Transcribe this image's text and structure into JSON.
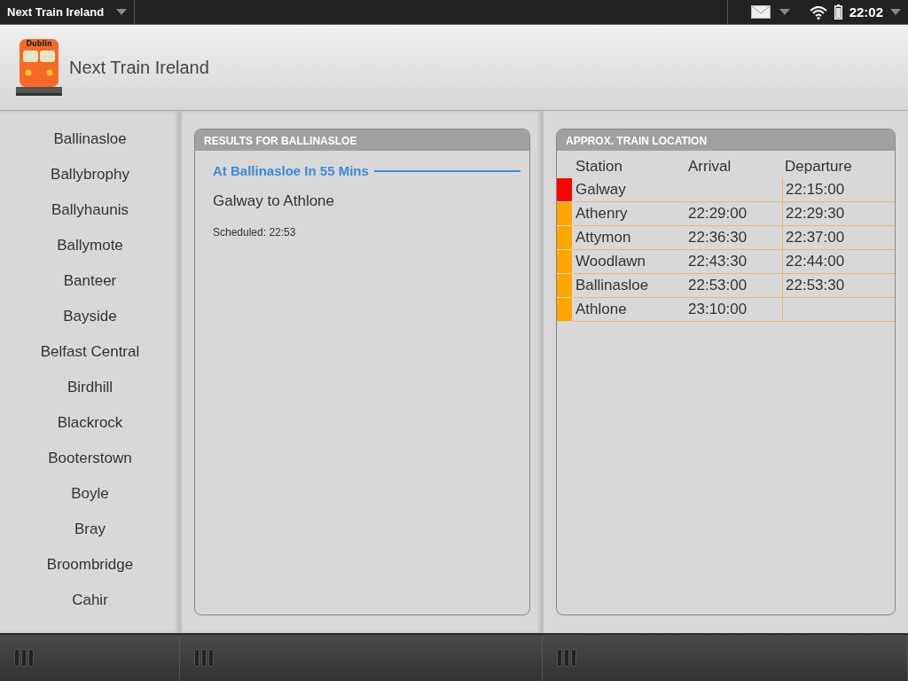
{
  "status_bar": {
    "app_name": "Next Train Ireland",
    "time": "22:02"
  },
  "header": {
    "title": "Next Train Ireland",
    "logo_text": "Dublin"
  },
  "sidebar": {
    "items": [
      {
        "label": "Ballinasloe"
      },
      {
        "label": "Ballybrophy"
      },
      {
        "label": "Ballyhaunis"
      },
      {
        "label": "Ballymote"
      },
      {
        "label": "Banteer"
      },
      {
        "label": "Bayside"
      },
      {
        "label": "Belfast Central"
      },
      {
        "label": "Birdhill"
      },
      {
        "label": "Blackrock"
      },
      {
        "label": "Booterstown"
      },
      {
        "label": "Boyle"
      },
      {
        "label": "Bray"
      },
      {
        "label": "Broombridge"
      },
      {
        "label": "Cahir"
      }
    ]
  },
  "results": {
    "title": "RESULTS FOR BALLINASLOE",
    "divider_label": "At Ballinasloe In 55 Mins",
    "route": "Galway to Athlone",
    "scheduled": "Scheduled: 22:53"
  },
  "location": {
    "title": "APPROX. TRAIN LOCATION",
    "columns": [
      "Station",
      "Arrival",
      "Departure"
    ],
    "rows": [
      {
        "color": "#ff0000",
        "station": "Galway",
        "arrival": "",
        "departure": "22:15:00"
      },
      {
        "color": "#ffa500",
        "station": "Athenry",
        "arrival": "22:29:00",
        "departure": "22:29:30"
      },
      {
        "color": "#ffa500",
        "station": "Attymon",
        "arrival": "22:36:30",
        "departure": "22:37:00"
      },
      {
        "color": "#ffa500",
        "station": "Woodlawn",
        "arrival": "22:43:30",
        "departure": "22:44:00"
      },
      {
        "color": "#ffa500",
        "station": "Ballinasloe",
        "arrival": "22:53:00",
        "departure": "22:53:30"
      },
      {
        "color": "#ffa500",
        "station": "Athlone",
        "arrival": "23:10:00",
        "departure": ""
      }
    ]
  }
}
